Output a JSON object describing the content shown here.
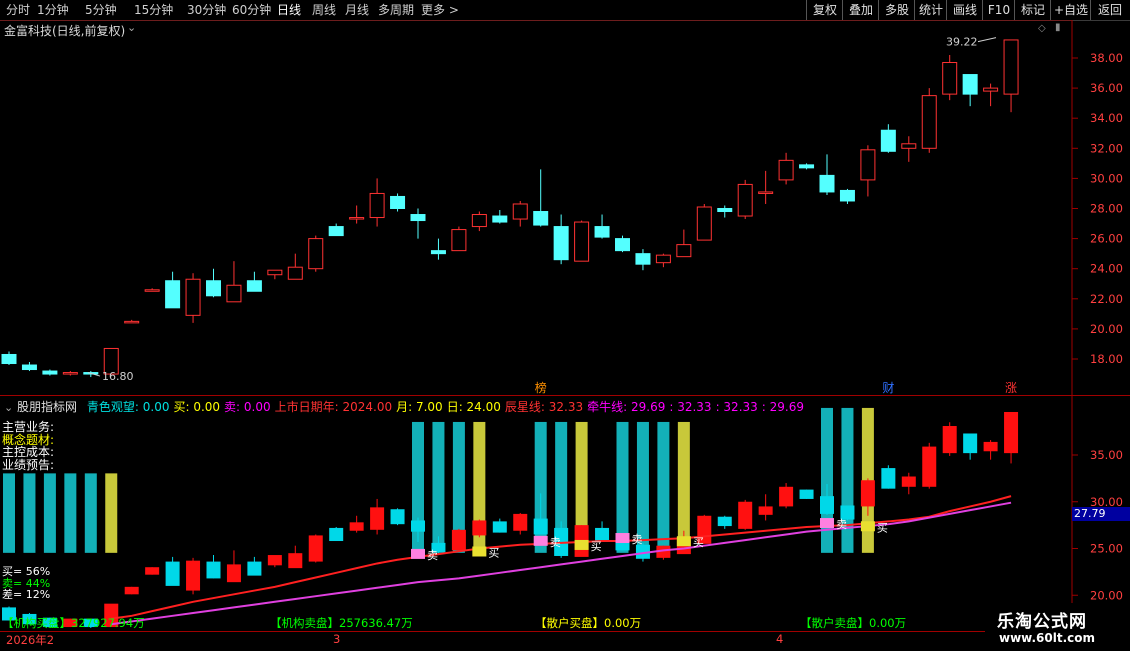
{
  "toolbar": {
    "timeframes": [
      "分时",
      "1分钟",
      "5分钟",
      "15分钟",
      "30分钟",
      "60分钟",
      "日线",
      "周线",
      "月线",
      "多周期",
      "更多 >"
    ],
    "active_timeframe": "日线",
    "buttons": [
      "复权",
      "叠加",
      "多股",
      "统计",
      "画线",
      "F10",
      "标记",
      "+自选",
      "返回"
    ]
  },
  "main_chart": {
    "title": "金富科技(日线,前复权)",
    "high_label": "39.22",
    "low_label": "16.80",
    "y_ticks": [
      "38.00",
      "36.00",
      "34.00",
      "32.00",
      "30.00",
      "28.00",
      "26.00",
      "24.00",
      "22.00",
      "20.00",
      "18.00"
    ],
    "event_markers": [
      "榜",
      "财",
      "涨"
    ],
    "colors": {
      "up": "#ff3232",
      "down": "#54ffff",
      "bg": "#000000",
      "grid": "#7a1010"
    }
  },
  "indicator": {
    "name": "股朋指标网",
    "params": [
      {
        "label": "青色观望:",
        "value": "0.00",
        "color": "#00e0e0"
      },
      {
        "label": "买:",
        "value": "0.00",
        "color": "#ffff00"
      },
      {
        "label": "卖:",
        "value": "0.00",
        "color": "#ff00ff"
      },
      {
        "label": "上市日期年:",
        "value": "2024.00",
        "color": "#ff3232"
      },
      {
        "label": "月:",
        "value": "7.00",
        "color": "#ffff00"
      },
      {
        "label": "日:",
        "value": "24.00",
        "color": "#ffff00"
      },
      {
        "label": "辰星线:",
        "value": "32.33",
        "color": "#ff3232"
      },
      {
        "label": "牵牛线:",
        "value": "29.69",
        "color": "#ff00ff"
      },
      {
        "label": ":",
        "value": "32.33",
        "color": "#ff00ff"
      },
      {
        "label": ":",
        "value": "32.33",
        "color": "#ff00ff"
      },
      {
        "label": ":",
        "value": "29.69",
        "color": "#ff00ff"
      }
    ],
    "left_labels": [
      "主营业务:",
      "概念题材:",
      "主控成本:",
      "业绩预告:"
    ],
    "ratio_labels": [
      {
        "text": "买= 56%",
        "color": "#ffffff"
      },
      {
        "text": "卖= 44%",
        "color": "#00ff00"
      },
      {
        "text": "差= 12%",
        "color": "#ffffff"
      }
    ],
    "price_tag": "27.79",
    "y_ticks": [
      "35.00",
      "30.00",
      "25.00",
      "20.00"
    ],
    "signal_buy": "买",
    "signal_sell": "卖",
    "bottom_stats": [
      {
        "label": "【机构买盘】",
        "value": "327927.94万"
      },
      {
        "label": "【机构卖盘】",
        "value": "257636.47万"
      },
      {
        "label": "【散户买盘】",
        "value": "0.00万"
      },
      {
        "label": "【散户卖盘】",
        "value": "0.00万"
      }
    ],
    "date_labels": [
      "2026年2",
      "3",
      "4"
    ]
  },
  "watermark": {
    "line1": "乐淘公式网",
    "line2": "www.60lt.com"
  },
  "candles": [
    {
      "o": 18.3,
      "h": 18.5,
      "l": 17.6,
      "c": 17.7
    },
    {
      "o": 17.6,
      "h": 17.8,
      "l": 17.2,
      "c": 17.3
    },
    {
      "o": 17.2,
      "h": 17.3,
      "l": 16.9,
      "c": 17.0
    },
    {
      "o": 17.0,
      "h": 17.2,
      "l": 16.9,
      "c": 17.1
    },
    {
      "o": 17.1,
      "h": 17.2,
      "l": 16.8,
      "c": 17.0
    },
    {
      "o": 17.0,
      "h": 18.7,
      "l": 17.0,
      "c": 18.7
    },
    {
      "o": 20.5,
      "h": 20.6,
      "l": 20.4,
      "c": 20.5
    },
    {
      "o": 22.6,
      "h": 22.7,
      "l": 22.5,
      "c": 22.6
    },
    {
      "o": 23.2,
      "h": 23.8,
      "l": 21.4,
      "c": 21.4
    },
    {
      "o": 20.9,
      "h": 23.7,
      "l": 20.4,
      "c": 23.3
    },
    {
      "o": 23.2,
      "h": 24.0,
      "l": 22.1,
      "c": 22.2
    },
    {
      "o": 21.8,
      "h": 24.5,
      "l": 21.8,
      "c": 22.9
    },
    {
      "o": 23.2,
      "h": 23.8,
      "l": 22.5,
      "c": 22.5
    },
    {
      "o": 23.6,
      "h": 23.9,
      "l": 23.3,
      "c": 23.9
    },
    {
      "o": 23.3,
      "h": 25.0,
      "l": 23.3,
      "c": 24.1
    },
    {
      "o": 24.0,
      "h": 26.2,
      "l": 23.8,
      "c": 26.0
    },
    {
      "o": 26.8,
      "h": 27.0,
      "l": 26.2,
      "c": 26.2
    },
    {
      "o": 27.3,
      "h": 28.2,
      "l": 27.0,
      "c": 27.4
    },
    {
      "o": 27.4,
      "h": 30.0,
      "l": 26.8,
      "c": 29.0
    },
    {
      "o": 28.8,
      "h": 29.0,
      "l": 27.8,
      "c": 28.0
    },
    {
      "o": 27.6,
      "h": 28.0,
      "l": 26.0,
      "c": 27.2
    },
    {
      "o": 25.2,
      "h": 26.0,
      "l": 24.6,
      "c": 25.0
    },
    {
      "o": 25.2,
      "h": 26.8,
      "l": 25.2,
      "c": 26.6
    },
    {
      "o": 26.8,
      "h": 27.8,
      "l": 26.5,
      "c": 27.6
    },
    {
      "o": 27.5,
      "h": 27.9,
      "l": 27.0,
      "c": 27.1
    },
    {
      "o": 27.3,
      "h": 28.5,
      "l": 26.8,
      "c": 28.3
    },
    {
      "o": 27.8,
      "h": 30.6,
      "l": 26.8,
      "c": 26.9
    },
    {
      "o": 26.8,
      "h": 27.6,
      "l": 24.3,
      "c": 24.6
    },
    {
      "o": 24.5,
      "h": 27.2,
      "l": 24.5,
      "c": 27.1
    },
    {
      "o": 26.8,
      "h": 27.6,
      "l": 26.0,
      "c": 26.1
    },
    {
      "o": 26.0,
      "h": 26.2,
      "l": 25.1,
      "c": 25.2
    },
    {
      "o": 25.0,
      "h": 25.3,
      "l": 23.9,
      "c": 24.3
    },
    {
      "o": 24.4,
      "h": 25.0,
      "l": 24.1,
      "c": 24.9
    },
    {
      "o": 24.8,
      "h": 26.6,
      "l": 24.8,
      "c": 25.6
    },
    {
      "o": 25.9,
      "h": 28.3,
      "l": 25.9,
      "c": 28.1
    },
    {
      "o": 28.0,
      "h": 28.2,
      "l": 27.4,
      "c": 27.8
    },
    {
      "o": 27.5,
      "h": 29.9,
      "l": 27.3,
      "c": 29.6
    },
    {
      "o": 29.0,
      "h": 30.5,
      "l": 28.3,
      "c": 29.1
    },
    {
      "o": 29.9,
      "h": 31.7,
      "l": 29.6,
      "c": 31.2
    },
    {
      "o": 30.9,
      "h": 31.0,
      "l": 30.6,
      "c": 30.7
    },
    {
      "o": 30.2,
      "h": 31.6,
      "l": 28.9,
      "c": 29.1
    },
    {
      "o": 29.2,
      "h": 29.3,
      "l": 28.3,
      "c": 28.5
    },
    {
      "o": 29.9,
      "h": 32.2,
      "l": 28.8,
      "c": 31.9
    },
    {
      "o": 33.2,
      "h": 33.6,
      "l": 31.7,
      "c": 31.8
    },
    {
      "o": 32.0,
      "h": 32.8,
      "l": 31.1,
      "c": 32.3
    },
    {
      "o": 32.0,
      "h": 36.0,
      "l": 31.7,
      "c": 35.5
    },
    {
      "o": 35.6,
      "h": 38.2,
      "l": 35.2,
      "c": 37.7
    },
    {
      "o": 36.9,
      "h": 36.9,
      "l": 34.8,
      "c": 35.6
    },
    {
      "o": 35.8,
      "h": 36.3,
      "l": 34.8,
      "c": 36.0
    },
    {
      "o": 35.6,
      "h": 39.2,
      "l": 34.4,
      "c": 39.2
    }
  ],
  "ind_bars": [
    {
      "t": 24.5,
      "b": 20.0,
      "c": "#13b0b8"
    },
    {
      "t": 24.5,
      "b": 20.0,
      "c": "#13b0b8"
    },
    {
      "t": 24.5,
      "b": 20.0,
      "c": "#13b0b8"
    },
    {
      "t": 24.5,
      "b": 20.0,
      "c": "#13b0b8"
    },
    {
      "t": 24.5,
      "b": 20.0,
      "c": "#13b0b8"
    },
    {
      "t": 24.5,
      "b": 20.0,
      "c": "#c8c83a"
    },
    {
      "t": 0,
      "b": 0,
      "c": ""
    },
    {
      "t": 0,
      "b": 0,
      "c": ""
    },
    {
      "t": 0,
      "b": 0,
      "c": ""
    },
    {
      "t": 0,
      "b": 0,
      "c": ""
    },
    {
      "t": 0,
      "b": 0,
      "c": ""
    },
    {
      "t": 0,
      "b": 0,
      "c": ""
    },
    {
      "t": 0,
      "b": 0,
      "c": ""
    },
    {
      "t": 0,
      "b": 0,
      "c": ""
    },
    {
      "t": 0,
      "b": 0,
      "c": ""
    },
    {
      "t": 0,
      "b": 0,
      "c": ""
    },
    {
      "t": 0,
      "b": 0,
      "c": ""
    },
    {
      "t": 0,
      "b": 0,
      "c": ""
    },
    {
      "t": 0,
      "b": 0,
      "c": ""
    },
    {
      "t": 0,
      "b": 0,
      "c": ""
    },
    {
      "t": 30.0,
      "b": 20.0,
      "c": "#13b0b8"
    },
    {
      "t": 30.0,
      "b": 20.0,
      "c": "#13b0b8"
    },
    {
      "t": 30.0,
      "b": 20.0,
      "c": "#13b0b8"
    },
    {
      "t": 30.0,
      "b": 20.0,
      "c": "#c8c83a"
    },
    {
      "t": 0,
      "b": 0,
      "c": ""
    },
    {
      "t": 0,
      "b": 0,
      "c": ""
    },
    {
      "t": 30.0,
      "b": 20.0,
      "c": "#13b0b8"
    },
    {
      "t": 30.0,
      "b": 20.0,
      "c": "#13b0b8"
    },
    {
      "t": 30.0,
      "b": 20.0,
      "c": "#c8c83a"
    },
    {
      "t": 0,
      "b": 0,
      "c": ""
    },
    {
      "t": 30.0,
      "b": 20.0,
      "c": "#13b0b8"
    },
    {
      "t": 30.0,
      "b": 20.0,
      "c": "#13b0b8"
    },
    {
      "t": 30.0,
      "b": 20.0,
      "c": "#13b0b8"
    },
    {
      "t": 30.0,
      "b": 20.0,
      "c": "#c8c83a"
    },
    {
      "t": 0,
      "b": 0,
      "c": ""
    },
    {
      "t": 0,
      "b": 0,
      "c": ""
    },
    {
      "t": 0,
      "b": 0,
      "c": ""
    },
    {
      "t": 0,
      "b": 0,
      "c": ""
    },
    {
      "t": 0,
      "b": 0,
      "c": ""
    },
    {
      "t": 0,
      "b": 0,
      "c": ""
    },
    {
      "t": 31.5,
      "b": 20.0,
      "c": "#13b0b8"
    },
    {
      "t": 31.5,
      "b": 20.0,
      "c": "#13b0b8"
    },
    {
      "t": 31.5,
      "b": 20.0,
      "c": "#c8c83a"
    },
    {
      "t": 0,
      "b": 0,
      "c": ""
    },
    {
      "t": 0,
      "b": 0,
      "c": ""
    },
    {
      "t": 0,
      "b": 0,
      "c": ""
    },
    {
      "t": 0,
      "b": 0,
      "c": ""
    },
    {
      "t": 0,
      "b": 0,
      "c": ""
    },
    {
      "t": 0,
      "b": 0,
      "c": ""
    },
    {
      "t": 0,
      "b": 0,
      "c": ""
    }
  ],
  "red_line": [
    null,
    null,
    null,
    null,
    null,
    17.5,
    17.8,
    18.3,
    18.8,
    19.3,
    19.7,
    20.1,
    20.5,
    20.9,
    21.4,
    21.9,
    22.4,
    22.9,
    23.4,
    23.8,
    24.1,
    24.4,
    24.7,
    25.0,
    25.2,
    25.4,
    25.5,
    25.6,
    25.7,
    25.8,
    25.8,
    25.9,
    26.0,
    26.1,
    26.3,
    26.5,
    26.7,
    26.9,
    27.1,
    27.3,
    27.4,
    27.5,
    27.7,
    27.9,
    28.1,
    28.4,
    29.0,
    29.5,
    30.0,
    30.6
  ],
  "mag_line": [
    null,
    null,
    null,
    null,
    null,
    16.9,
    17.2,
    17.5,
    17.8,
    18.1,
    18.4,
    18.7,
    19.0,
    19.3,
    19.6,
    19.9,
    20.2,
    20.5,
    20.8,
    21.1,
    21.4,
    21.6,
    21.8,
    22.1,
    22.4,
    22.7,
    23.0,
    23.3,
    23.6,
    23.9,
    24.2,
    24.5,
    24.8,
    25.0,
    25.3,
    25.6,
    25.9,
    26.2,
    26.5,
    26.8,
    27.0,
    27.2,
    27.4,
    27.6,
    27.9,
    28.3,
    28.7,
    29.1,
    29.5,
    29.9
  ],
  "signals": [
    {
      "i": 20,
      "t": "sell"
    },
    {
      "i": 23,
      "t": "buy"
    },
    {
      "i": 26,
      "t": "sell"
    },
    {
      "i": 28,
      "t": "buy"
    },
    {
      "i": 30,
      "t": "sell"
    },
    {
      "i": 33,
      "t": "buy"
    },
    {
      "i": 40,
      "t": "sell"
    },
    {
      "i": 42,
      "t": "buy"
    }
  ]
}
